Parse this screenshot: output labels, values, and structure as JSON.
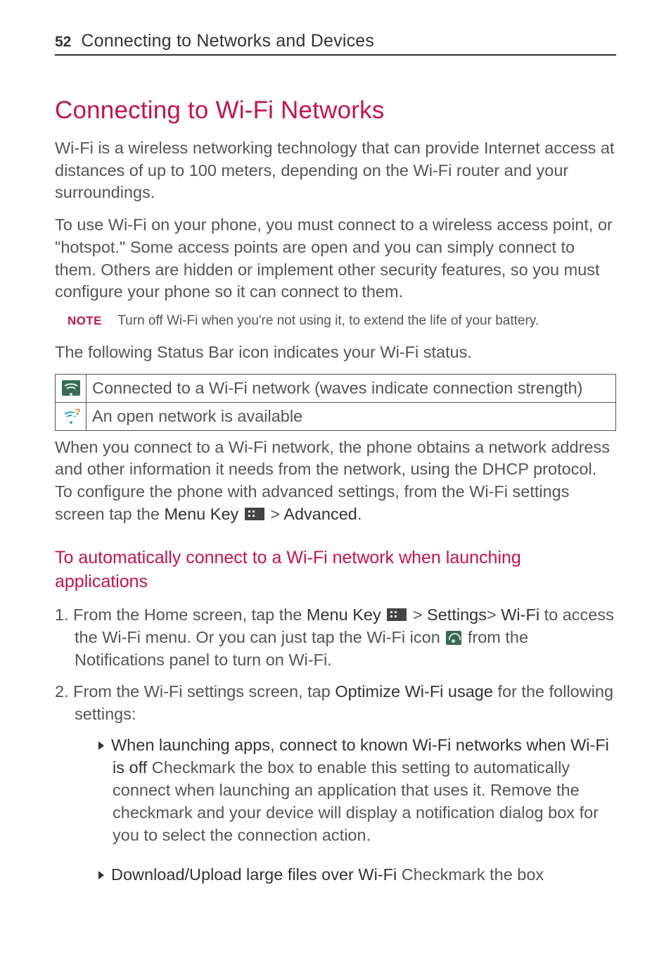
{
  "header": {
    "page_number": "52",
    "section_title": "Connecting to Networks and Devices"
  },
  "title": "Connecting to Wi-Fi Networks",
  "intro1": "Wi-Fi is a wireless networking technology that can provide Internet access at distances of up to 100 meters, depending on the Wi-Fi router and your surroundings.",
  "intro2": "To use Wi-Fi on your phone, you must connect to a wireless access point, or \"hotspot.\" Some access points are open and you can simply connect to them. Others are hidden or implement other security features, so you must configure your phone so it can connect to them.",
  "note": {
    "label": "NOTE",
    "text": "Turn off Wi-Fi when you're not using it, to extend the life of your battery."
  },
  "status_para": "The following Status Bar icon indicates your Wi-Fi status.",
  "table": {
    "row1": {
      "icon": "wifi-connected-icon",
      "text": "Connected to a Wi-Fi network (waves indicate connection strength)"
    },
    "row2": {
      "icon": "wifi-open-icon",
      "text": "An open network is available"
    }
  },
  "dhcp": {
    "pre": "When you connect to a Wi-Fi network, the phone obtains a network address and other information it needs from the network, using the DHCP protocol. To configure the phone with advanced settings, from the Wi-Fi settings screen tap the ",
    "menu_key": "Menu Key",
    "gt": " > ",
    "advanced": "Advanced",
    "period": "."
  },
  "h2": "To automatically connect to a Wi-Fi network when launching applications",
  "steps": {
    "s1": {
      "num": "1.  ",
      "a": "From the Home screen, tap the ",
      "menu_key": "Menu Key",
      "gt": " > ",
      "settings": "Settings",
      "gt2": "> ",
      "wifi": "Wi-Fi",
      "b": " to access  the Wi-Fi menu. Or you can just tap the Wi-Fi icon ",
      "c": " from the Notifications panel to turn on Wi-Fi."
    },
    "s2": {
      "num": "2.  ",
      "a": "From the Wi-Fi settings screen, tap ",
      "opt": "Optimize Wi-Fi usage",
      "b": " for the following settings:"
    },
    "b1": {
      "bold1": "When launching apps, connect to known Wi-Fi networks when Wi-Fi is off",
      "rest": "  Checkmark the box to enable this setting to automatically connect when launching an application that uses it. Remove the checkmark and your device will display a notification dialog box for you to select the connection action."
    },
    "b2": {
      "bold1": "Download/Upload large files over Wi-Fi",
      "rest": "  Checkmark the box"
    }
  }
}
